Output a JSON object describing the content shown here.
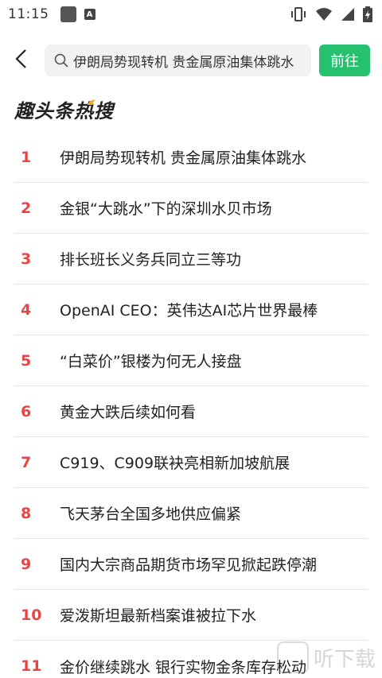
{
  "status_bar": {
    "time": "11:15",
    "left_icons": [
      "square-icon",
      "a-icon"
    ],
    "right_icons": [
      "vibrate-icon",
      "wifi-icon",
      "signal-icon",
      "battery-icon"
    ]
  },
  "top_bar": {
    "back_icon": "chevron-left-icon",
    "search_value": "伊朗局势现转机 贵金属原油集体跳水",
    "go_label": "前往",
    "accent_color": "#25c16f"
  },
  "section": {
    "title": "趣头条热搜"
  },
  "hot_list": [
    {
      "rank": "1",
      "text": "伊朗局势现转机 贵金属原油集体跳水"
    },
    {
      "rank": "2",
      "text": "金银“大跳水”下的深圳水贝市场"
    },
    {
      "rank": "3",
      "text": "排长班长义务兵同立三等功"
    },
    {
      "rank": "4",
      "text": "OpenAI CEO：英伟达AI芯片世界最棒"
    },
    {
      "rank": "5",
      "text": "“白菜价”银楼为何无人接盘"
    },
    {
      "rank": "6",
      "text": "黄金大跌后续如何看"
    },
    {
      "rank": "7",
      "text": "C919、C909联袂亮相新加坡航展"
    },
    {
      "rank": "8",
      "text": "飞天茅台全国多地供应偏紧"
    },
    {
      "rank": "9",
      "text": "国内大宗商品期货市场罕见掀起跌停潮"
    },
    {
      "rank": "10",
      "text": "爱泼斯坦最新档案谁被拉下水"
    },
    {
      "rank": "11",
      "text": "金价继续跳水 银行实物金条库存松动"
    }
  ],
  "rank_color": "#e84545",
  "watermark": {
    "text": "听下载"
  }
}
